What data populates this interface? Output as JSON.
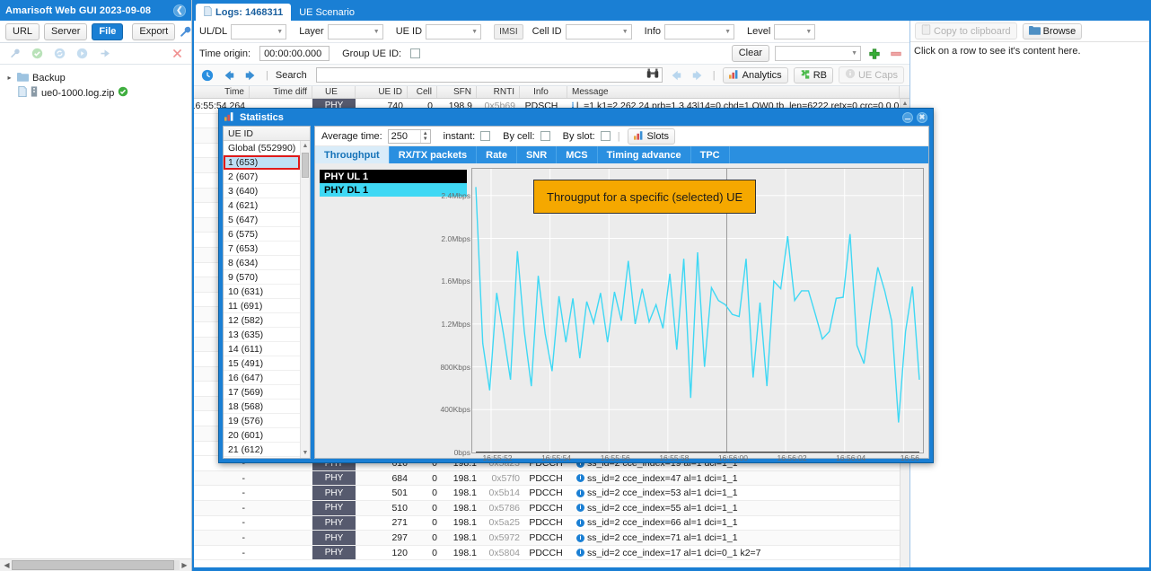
{
  "left_panel": {
    "title": "Amarisoft Web GUI 2023-09-08",
    "collapse_icon": "chevron-left-icon",
    "tabs": [
      {
        "label": "URL",
        "active": false
      },
      {
        "label": "Server",
        "active": false
      },
      {
        "label": "File",
        "active": true
      }
    ],
    "export_label": "Export",
    "settings_icon": "wrench-icon",
    "toolbar_icons": [
      "wrench-icon",
      "check-circle-icon",
      "refresh-icon",
      "play-circle-icon",
      "plug-icon",
      "close-x-icon"
    ],
    "tree": [
      {
        "label": "Backup",
        "icon": "folder-icon",
        "expander": "▸",
        "depth": 0,
        "status": ""
      },
      {
        "label": "ue0-1000.log.zip",
        "icon": "file-icon",
        "expander": "",
        "depth": 1,
        "status": "ok-icon"
      }
    ]
  },
  "tabs": [
    {
      "label": "Logs: 1468311",
      "icon": "file-icon",
      "active": true
    },
    {
      "label": "UE Scenario",
      "icon": "",
      "active": false
    }
  ],
  "filters": {
    "uldl": {
      "label": "UL/DL",
      "value": ""
    },
    "layer": {
      "label": "Layer",
      "value": ""
    },
    "ueid": {
      "label": "UE ID",
      "value": ""
    },
    "imsi": {
      "label": "IMSI"
    },
    "cellid": {
      "label": "Cell ID",
      "value": ""
    },
    "info": {
      "label": "Info",
      "value": ""
    },
    "level": {
      "label": "Level",
      "value": ""
    }
  },
  "row2": {
    "time_origin_label": "Time origin:",
    "time_origin_value": "00:00:00.000",
    "group_ueid_label": "Group UE ID:",
    "group_ueid_checked": false,
    "clear_label": "Clear",
    "preset_value": "",
    "add_icon": "plus-icon",
    "remove_icon": "minus-icon"
  },
  "searchbar": {
    "clock_icon": "clock-icon",
    "prev_icon": "arrow-left-icon",
    "next_icon": "arrow-right-icon",
    "search_label": "Search",
    "search_value": "",
    "binoculars_icon": "binoculars-icon",
    "find_prev_icon": "arrow-left-icon",
    "find_next_icon": "arrow-right-icon",
    "analytics_label": "Analytics",
    "rb_label": "RB",
    "uecaps_label": "UE Caps"
  },
  "table": {
    "columns": [
      "Time",
      "Time diff",
      "UE",
      "UE ID",
      "Cell",
      "SFN",
      "RNTI",
      "Info",
      "Message"
    ],
    "rows": [
      {
        "time": "-",
        "timediff": "",
        "ue": "PHY",
        "dir": "down-arrow-icon",
        "ueid": "616",
        "cell": "0",
        "sfn": "198.1",
        "rnti": "0x5a23",
        "info": "PDCCH",
        "message": "ss_id=2 cce_index=19 al=1 dci=1_1"
      },
      {
        "time": "-",
        "timediff": "",
        "ue": "PHY",
        "dir": "down-arrow-icon",
        "ueid": "684",
        "cell": "0",
        "sfn": "198.1",
        "rnti": "0x57f0",
        "info": "PDCCH",
        "message": "ss_id=2 cce_index=47 al=1 dci=1_1"
      },
      {
        "time": "-",
        "timediff": "",
        "ue": "PHY",
        "dir": "down-arrow-icon",
        "ueid": "501",
        "cell": "0",
        "sfn": "198.1",
        "rnti": "0x5b14",
        "info": "PDCCH",
        "message": "ss_id=2 cce_index=53 al=1 dci=1_1"
      },
      {
        "time": "-",
        "timediff": "",
        "ue": "PHY",
        "dir": "down-arrow-icon",
        "ueid": "510",
        "cell": "0",
        "sfn": "198.1",
        "rnti": "0x5786",
        "info": "PDCCH",
        "message": "ss_id=2 cce_index=55 al=1 dci=1_1"
      },
      {
        "time": "-",
        "timediff": "",
        "ue": "PHY",
        "dir": "down-arrow-icon",
        "ueid": "271",
        "cell": "0",
        "sfn": "198.1",
        "rnti": "0x5a25",
        "info": "PDCCH",
        "message": "ss_id=2 cce_index=66 al=1 dci=1_1"
      },
      {
        "time": "-",
        "timediff": "",
        "ue": "PHY",
        "dir": "down-arrow-icon",
        "ueid": "297",
        "cell": "0",
        "sfn": "198.1",
        "rnti": "0x5972",
        "info": "PDCCH",
        "message": "ss_id=2 cce_index=71 al=1 dci=1_1"
      },
      {
        "time": "-",
        "timediff": "",
        "ue": "PHY",
        "dir": "down-arrow-icon",
        "ueid": "120",
        "cell": "0",
        "sfn": "198.1",
        "rnti": "0x5804",
        "info": "PDCCH",
        "message": "ss_id=2 cce_index=17 al=1 dci=0_1 k2=7"
      }
    ]
  },
  "detail": {
    "copy_label": "Copy to clipboard",
    "browse_label": "Browse",
    "empty_text": "Click on a row to see it's content here."
  },
  "dialog": {
    "title": "Statistics",
    "title_icon": "chart-icon",
    "minimize_icon": "minimize-icon",
    "close_icon": "close-icon",
    "ue_list_header": "UE ID",
    "ue_items": [
      {
        "label": "Global (552990)",
        "selected": false
      },
      {
        "label": "1 (653)",
        "selected": true
      },
      {
        "label": "2 (607)",
        "selected": false
      },
      {
        "label": "3 (640)",
        "selected": false
      },
      {
        "label": "4 (621)",
        "selected": false
      },
      {
        "label": "5 (647)",
        "selected": false
      },
      {
        "label": "6 (575)",
        "selected": false
      },
      {
        "label": "7 (653)",
        "selected": false
      },
      {
        "label": "8 (634)",
        "selected": false
      },
      {
        "label": "9 (570)",
        "selected": false
      },
      {
        "label": "10 (631)",
        "selected": false
      },
      {
        "label": "11 (691)",
        "selected": false
      },
      {
        "label": "12 (582)",
        "selected": false
      },
      {
        "label": "13 (635)",
        "selected": false
      },
      {
        "label": "14 (611)",
        "selected": false
      },
      {
        "label": "15 (491)",
        "selected": false
      },
      {
        "label": "16 (647)",
        "selected": false
      },
      {
        "label": "17 (569)",
        "selected": false
      },
      {
        "label": "18 (568)",
        "selected": false
      },
      {
        "label": "19 (576)",
        "selected": false
      },
      {
        "label": "20 (601)",
        "selected": false
      },
      {
        "label": "21 (612)",
        "selected": false
      }
    ],
    "options": {
      "average_time_label": "Average time:",
      "average_time_value": "250",
      "instant_label": "instant:",
      "instant_checked": false,
      "by_cell_label": "By cell:",
      "by_cell_checked": false,
      "by_slot_label": "By slot:",
      "by_slot_checked": false,
      "slots_label": "Slots",
      "slots_icon": "chart-icon"
    },
    "tabs": [
      {
        "label": "Throughput",
        "active": true
      },
      {
        "label": "RX/TX packets",
        "active": false
      },
      {
        "label": "Rate",
        "active": false
      },
      {
        "label": "SNR",
        "active": false
      },
      {
        "label": "MCS",
        "active": false
      },
      {
        "label": "Timing advance",
        "active": false
      },
      {
        "label": "TPC",
        "active": false
      }
    ],
    "annotation": "Througput for a specific (selected) UE",
    "annotation_bg": "#f5a800"
  },
  "chart_data": {
    "type": "line",
    "title": "",
    "xlabel": "",
    "ylabel": "",
    "ylim": [
      0,
      2650000
    ],
    "ytick_labels": [
      "0bps",
      "400Kbps",
      "800Kbps",
      "1.2Mbps",
      "1.6Mbps",
      "2.0Mbps",
      "2.4Mbps"
    ],
    "ytick_values": [
      0,
      400000,
      800000,
      1200000,
      1600000,
      2000000,
      2400000
    ],
    "xtick_labels": [
      "16:55:52",
      "16:55:54",
      "16:55:56",
      "16:55:58",
      "16:56:00",
      "16:56:02",
      "16:56:04",
      "16:56"
    ],
    "grid": true,
    "legend_position": "left",
    "series": [
      {
        "name": "PHY UL 1",
        "color": "#000000",
        "text_color": "#ffffff",
        "values": []
      },
      {
        "name": "PHY DL 1",
        "color": "#3fd8f4",
        "text_color": "#000000",
        "values": [
          2480000,
          1020000,
          580000,
          1490000,
          1100000,
          680000,
          1880000,
          1130000,
          620000,
          1650000,
          1110000,
          760000,
          1460000,
          1030000,
          1440000,
          880000,
          1410000,
          1210000,
          1490000,
          1030000,
          1500000,
          1230000,
          1790000,
          1200000,
          1530000,
          1220000,
          1380000,
          1160000,
          1670000,
          960000,
          1810000,
          510000,
          1870000,
          800000,
          1540000,
          1420000,
          1380000,
          1290000,
          1270000,
          1810000,
          700000,
          1400000,
          620000,
          1600000,
          1530000,
          2020000,
          1420000,
          1510000,
          1510000,
          1290000,
          1060000,
          1130000,
          1440000,
          1450000,
          2040000,
          1000000,
          830000,
          1310000,
          1730000,
          1510000,
          1230000,
          280000,
          1130000,
          1550000,
          680000
        ]
      }
    ]
  }
}
